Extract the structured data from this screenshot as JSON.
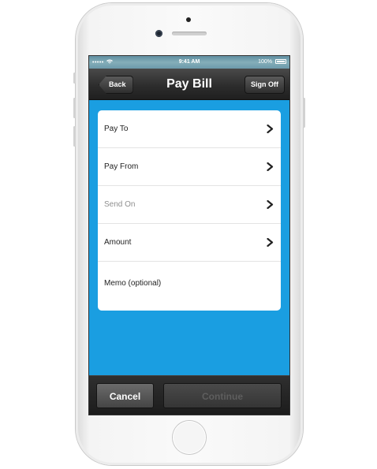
{
  "status_bar": {
    "carrier": "•••••",
    "time": "9:41 AM",
    "battery": "100%"
  },
  "nav": {
    "title": "Pay Bill",
    "back_label": "Back",
    "signoff_label": "Sign Off"
  },
  "form": {
    "rows": [
      {
        "label": "Pay To",
        "enabled": true,
        "has_chevron": true
      },
      {
        "label": "Pay From",
        "enabled": true,
        "has_chevron": true
      },
      {
        "label": "Send On",
        "enabled": false,
        "has_chevron": true
      },
      {
        "label": "Amount",
        "enabled": true,
        "has_chevron": true
      },
      {
        "label": "Memo (optional)",
        "enabled": true,
        "has_chevron": false
      }
    ]
  },
  "toolbar": {
    "cancel_label": "Cancel",
    "continue_label": "Continue",
    "continue_enabled": false
  },
  "colors": {
    "content_background": "#1a9ee1",
    "nav_background": "#2d2d2d",
    "disabled_text": "#8f8f8f"
  },
  "icons": {
    "row_chevron": "chevron-right-icon",
    "back": "back-arrow-shape",
    "wifi": "wifi-icon",
    "battery": "battery-icon"
  }
}
